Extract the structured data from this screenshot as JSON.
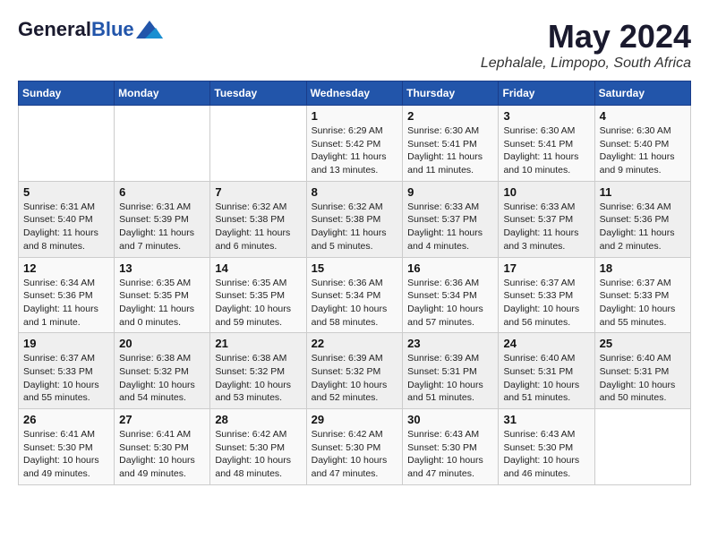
{
  "header": {
    "logo_general": "General",
    "logo_blue": "Blue",
    "month_title": "May 2024",
    "location": "Lephalale, Limpopo, South Africa"
  },
  "days_of_week": [
    "Sunday",
    "Monday",
    "Tuesday",
    "Wednesday",
    "Thursday",
    "Friday",
    "Saturday"
  ],
  "weeks": [
    [
      {
        "day": "",
        "sunrise": "",
        "sunset": "",
        "daylight": ""
      },
      {
        "day": "",
        "sunrise": "",
        "sunset": "",
        "daylight": ""
      },
      {
        "day": "",
        "sunrise": "",
        "sunset": "",
        "daylight": ""
      },
      {
        "day": "1",
        "sunrise": "Sunrise: 6:29 AM",
        "sunset": "Sunset: 5:42 PM",
        "daylight": "Daylight: 11 hours and 13 minutes."
      },
      {
        "day": "2",
        "sunrise": "Sunrise: 6:30 AM",
        "sunset": "Sunset: 5:41 PM",
        "daylight": "Daylight: 11 hours and 11 minutes."
      },
      {
        "day": "3",
        "sunrise": "Sunrise: 6:30 AM",
        "sunset": "Sunset: 5:41 PM",
        "daylight": "Daylight: 11 hours and 10 minutes."
      },
      {
        "day": "4",
        "sunrise": "Sunrise: 6:30 AM",
        "sunset": "Sunset: 5:40 PM",
        "daylight": "Daylight: 11 hours and 9 minutes."
      }
    ],
    [
      {
        "day": "5",
        "sunrise": "Sunrise: 6:31 AM",
        "sunset": "Sunset: 5:40 PM",
        "daylight": "Daylight: 11 hours and 8 minutes."
      },
      {
        "day": "6",
        "sunrise": "Sunrise: 6:31 AM",
        "sunset": "Sunset: 5:39 PM",
        "daylight": "Daylight: 11 hours and 7 minutes."
      },
      {
        "day": "7",
        "sunrise": "Sunrise: 6:32 AM",
        "sunset": "Sunset: 5:38 PM",
        "daylight": "Daylight: 11 hours and 6 minutes."
      },
      {
        "day": "8",
        "sunrise": "Sunrise: 6:32 AM",
        "sunset": "Sunset: 5:38 PM",
        "daylight": "Daylight: 11 hours and 5 minutes."
      },
      {
        "day": "9",
        "sunrise": "Sunrise: 6:33 AM",
        "sunset": "Sunset: 5:37 PM",
        "daylight": "Daylight: 11 hours and 4 minutes."
      },
      {
        "day": "10",
        "sunrise": "Sunrise: 6:33 AM",
        "sunset": "Sunset: 5:37 PM",
        "daylight": "Daylight: 11 hours and 3 minutes."
      },
      {
        "day": "11",
        "sunrise": "Sunrise: 6:34 AM",
        "sunset": "Sunset: 5:36 PM",
        "daylight": "Daylight: 11 hours and 2 minutes."
      }
    ],
    [
      {
        "day": "12",
        "sunrise": "Sunrise: 6:34 AM",
        "sunset": "Sunset: 5:36 PM",
        "daylight": "Daylight: 11 hours and 1 minute."
      },
      {
        "day": "13",
        "sunrise": "Sunrise: 6:35 AM",
        "sunset": "Sunset: 5:35 PM",
        "daylight": "Daylight: 11 hours and 0 minutes."
      },
      {
        "day": "14",
        "sunrise": "Sunrise: 6:35 AM",
        "sunset": "Sunset: 5:35 PM",
        "daylight": "Daylight: 10 hours and 59 minutes."
      },
      {
        "day": "15",
        "sunrise": "Sunrise: 6:36 AM",
        "sunset": "Sunset: 5:34 PM",
        "daylight": "Daylight: 10 hours and 58 minutes."
      },
      {
        "day": "16",
        "sunrise": "Sunrise: 6:36 AM",
        "sunset": "Sunset: 5:34 PM",
        "daylight": "Daylight: 10 hours and 57 minutes."
      },
      {
        "day": "17",
        "sunrise": "Sunrise: 6:37 AM",
        "sunset": "Sunset: 5:33 PM",
        "daylight": "Daylight: 10 hours and 56 minutes."
      },
      {
        "day": "18",
        "sunrise": "Sunrise: 6:37 AM",
        "sunset": "Sunset: 5:33 PM",
        "daylight": "Daylight: 10 hours and 55 minutes."
      }
    ],
    [
      {
        "day": "19",
        "sunrise": "Sunrise: 6:37 AM",
        "sunset": "Sunset: 5:33 PM",
        "daylight": "Daylight: 10 hours and 55 minutes."
      },
      {
        "day": "20",
        "sunrise": "Sunrise: 6:38 AM",
        "sunset": "Sunset: 5:32 PM",
        "daylight": "Daylight: 10 hours and 54 minutes."
      },
      {
        "day": "21",
        "sunrise": "Sunrise: 6:38 AM",
        "sunset": "Sunset: 5:32 PM",
        "daylight": "Daylight: 10 hours and 53 minutes."
      },
      {
        "day": "22",
        "sunrise": "Sunrise: 6:39 AM",
        "sunset": "Sunset: 5:32 PM",
        "daylight": "Daylight: 10 hours and 52 minutes."
      },
      {
        "day": "23",
        "sunrise": "Sunrise: 6:39 AM",
        "sunset": "Sunset: 5:31 PM",
        "daylight": "Daylight: 10 hours and 51 minutes."
      },
      {
        "day": "24",
        "sunrise": "Sunrise: 6:40 AM",
        "sunset": "Sunset: 5:31 PM",
        "daylight": "Daylight: 10 hours and 51 minutes."
      },
      {
        "day": "25",
        "sunrise": "Sunrise: 6:40 AM",
        "sunset": "Sunset: 5:31 PM",
        "daylight": "Daylight: 10 hours and 50 minutes."
      }
    ],
    [
      {
        "day": "26",
        "sunrise": "Sunrise: 6:41 AM",
        "sunset": "Sunset: 5:30 PM",
        "daylight": "Daylight: 10 hours and 49 minutes."
      },
      {
        "day": "27",
        "sunrise": "Sunrise: 6:41 AM",
        "sunset": "Sunset: 5:30 PM",
        "daylight": "Daylight: 10 hours and 49 minutes."
      },
      {
        "day": "28",
        "sunrise": "Sunrise: 6:42 AM",
        "sunset": "Sunset: 5:30 PM",
        "daylight": "Daylight: 10 hours and 48 minutes."
      },
      {
        "day": "29",
        "sunrise": "Sunrise: 6:42 AM",
        "sunset": "Sunset: 5:30 PM",
        "daylight": "Daylight: 10 hours and 47 minutes."
      },
      {
        "day": "30",
        "sunrise": "Sunrise: 6:43 AM",
        "sunset": "Sunset: 5:30 PM",
        "daylight": "Daylight: 10 hours and 47 minutes."
      },
      {
        "day": "31",
        "sunrise": "Sunrise: 6:43 AM",
        "sunset": "Sunset: 5:30 PM",
        "daylight": "Daylight: 10 hours and 46 minutes."
      },
      {
        "day": "",
        "sunrise": "",
        "sunset": "",
        "daylight": ""
      }
    ]
  ]
}
